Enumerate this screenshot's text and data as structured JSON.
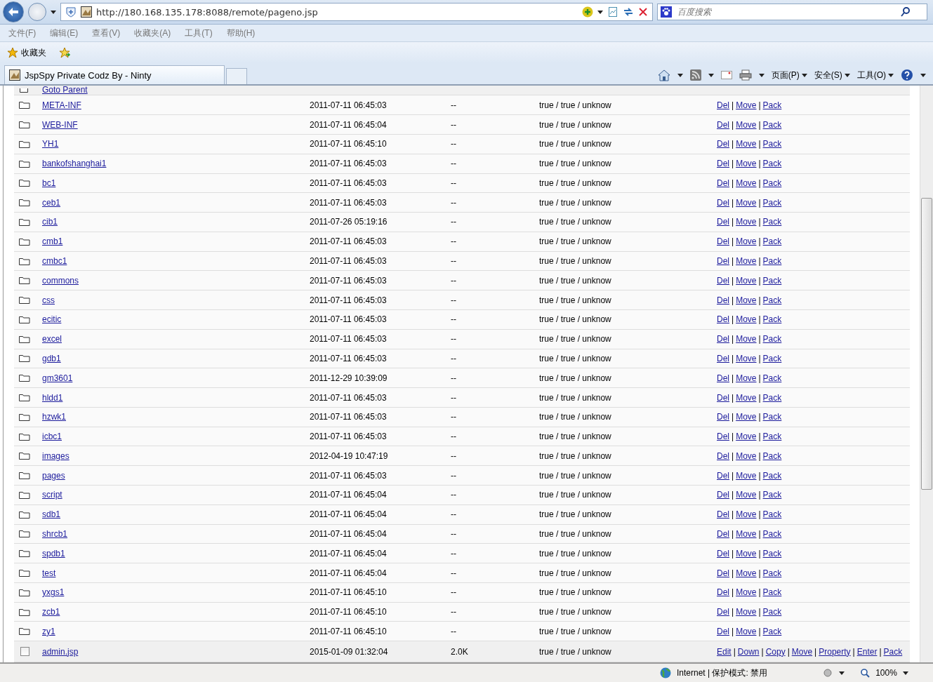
{
  "action_separator": "|",
  "address_bar": {
    "url": "http://180.168.135.178:8088/remote/pageno.jsp",
    "search_placeholder": "百度搜索"
  },
  "menu_bar": [
    "文件(F)",
    "编辑(E)",
    "查看(V)",
    "收藏夹(A)",
    "工具(T)",
    "帮助(H)"
  ],
  "favorites_bar": {
    "label": "收藏夹"
  },
  "tab": {
    "title": "JspSpy Private Codz By - Ninty"
  },
  "command_bar": [
    "页面(P)",
    "安全(S)",
    "工具(O)"
  ],
  "listing": {
    "parent_link": "Goto Parent",
    "rows": [
      {
        "kind": "folder",
        "name": "META-INF",
        "modified": "2011-07-11 06:45:03",
        "size": "--",
        "permissions": "true / true / unknow",
        "actions": [
          "Del",
          "Move",
          "Pack"
        ]
      },
      {
        "kind": "folder",
        "name": "WEB-INF",
        "modified": "2011-07-11 06:45:04",
        "size": "--",
        "permissions": "true / true / unknow",
        "actions": [
          "Del",
          "Move",
          "Pack"
        ]
      },
      {
        "kind": "folder",
        "name": "YH1",
        "modified": "2011-07-11 06:45:10",
        "size": "--",
        "permissions": "true / true / unknow",
        "actions": [
          "Del",
          "Move",
          "Pack"
        ]
      },
      {
        "kind": "folder",
        "name": "bankofshanghai1",
        "modified": "2011-07-11 06:45:03",
        "size": "--",
        "permissions": "true / true / unknow",
        "actions": [
          "Del",
          "Move",
          "Pack"
        ]
      },
      {
        "kind": "folder",
        "name": "bc1",
        "modified": "2011-07-11 06:45:03",
        "size": "--",
        "permissions": "true / true / unknow",
        "actions": [
          "Del",
          "Move",
          "Pack"
        ]
      },
      {
        "kind": "folder",
        "name": "ceb1",
        "modified": "2011-07-11 06:45:03",
        "size": "--",
        "permissions": "true / true / unknow",
        "actions": [
          "Del",
          "Move",
          "Pack"
        ]
      },
      {
        "kind": "folder",
        "name": "cib1",
        "modified": "2011-07-26 05:19:16",
        "size": "--",
        "permissions": "true / true / unknow",
        "actions": [
          "Del",
          "Move",
          "Pack"
        ]
      },
      {
        "kind": "folder",
        "name": "cmb1",
        "modified": "2011-07-11 06:45:03",
        "size": "--",
        "permissions": "true / true / unknow",
        "actions": [
          "Del",
          "Move",
          "Pack"
        ]
      },
      {
        "kind": "folder",
        "name": "cmbc1",
        "modified": "2011-07-11 06:45:03",
        "size": "--",
        "permissions": "true / true / unknow",
        "actions": [
          "Del",
          "Move",
          "Pack"
        ]
      },
      {
        "kind": "folder",
        "name": "commons",
        "modified": "2011-07-11 06:45:03",
        "size": "--",
        "permissions": "true / true / unknow",
        "actions": [
          "Del",
          "Move",
          "Pack"
        ]
      },
      {
        "kind": "folder",
        "name": "css",
        "modified": "2011-07-11 06:45:03",
        "size": "--",
        "permissions": "true / true / unknow",
        "actions": [
          "Del",
          "Move",
          "Pack"
        ]
      },
      {
        "kind": "folder",
        "name": "ecitic",
        "modified": "2011-07-11 06:45:03",
        "size": "--",
        "permissions": "true / true / unknow",
        "actions": [
          "Del",
          "Move",
          "Pack"
        ]
      },
      {
        "kind": "folder",
        "name": "excel",
        "modified": "2011-07-11 06:45:03",
        "size": "--",
        "permissions": "true / true / unknow",
        "actions": [
          "Del",
          "Move",
          "Pack"
        ]
      },
      {
        "kind": "folder",
        "name": "gdb1",
        "modified": "2011-07-11 06:45:03",
        "size": "--",
        "permissions": "true / true / unknow",
        "actions": [
          "Del",
          "Move",
          "Pack"
        ]
      },
      {
        "kind": "folder",
        "name": "gm3601",
        "modified": "2011-12-29 10:39:09",
        "size": "--",
        "permissions": "true / true / unknow",
        "actions": [
          "Del",
          "Move",
          "Pack"
        ]
      },
      {
        "kind": "folder",
        "name": "hldd1",
        "modified": "2011-07-11 06:45:03",
        "size": "--",
        "permissions": "true / true / unknow",
        "actions": [
          "Del",
          "Move",
          "Pack"
        ]
      },
      {
        "kind": "folder",
        "name": "hzwk1",
        "modified": "2011-07-11 06:45:03",
        "size": "--",
        "permissions": "true / true / unknow",
        "actions": [
          "Del",
          "Move",
          "Pack"
        ]
      },
      {
        "kind": "folder",
        "name": "icbc1",
        "modified": "2011-07-11 06:45:03",
        "size": "--",
        "permissions": "true / true / unknow",
        "actions": [
          "Del",
          "Move",
          "Pack"
        ]
      },
      {
        "kind": "folder",
        "name": "images",
        "modified": "2012-04-19 10:47:19",
        "size": "--",
        "permissions": "true / true / unknow",
        "actions": [
          "Del",
          "Move",
          "Pack"
        ]
      },
      {
        "kind": "folder",
        "name": "pages",
        "modified": "2011-07-11 06:45:03",
        "size": "--",
        "permissions": "true / true / unknow",
        "actions": [
          "Del",
          "Move",
          "Pack"
        ]
      },
      {
        "kind": "folder",
        "name": "script",
        "modified": "2011-07-11 06:45:04",
        "size": "--",
        "permissions": "true / true / unknow",
        "actions": [
          "Del",
          "Move",
          "Pack"
        ]
      },
      {
        "kind": "folder",
        "name": "sdb1",
        "modified": "2011-07-11 06:45:04",
        "size": "--",
        "permissions": "true / true / unknow",
        "actions": [
          "Del",
          "Move",
          "Pack"
        ]
      },
      {
        "kind": "folder",
        "name": "shrcb1",
        "modified": "2011-07-11 06:45:04",
        "size": "--",
        "permissions": "true / true / unknow",
        "actions": [
          "Del",
          "Move",
          "Pack"
        ]
      },
      {
        "kind": "folder",
        "name": "spdb1",
        "modified": "2011-07-11 06:45:04",
        "size": "--",
        "permissions": "true / true / unknow",
        "actions": [
          "Del",
          "Move",
          "Pack"
        ]
      },
      {
        "kind": "folder",
        "name": "test",
        "modified": "2011-07-11 06:45:04",
        "size": "--",
        "permissions": "true / true / unknow",
        "actions": [
          "Del",
          "Move",
          "Pack"
        ]
      },
      {
        "kind": "folder",
        "name": "yxgs1",
        "modified": "2011-07-11 06:45:10",
        "size": "--",
        "permissions": "true / true / unknow",
        "actions": [
          "Del",
          "Move",
          "Pack"
        ]
      },
      {
        "kind": "folder",
        "name": "zcb1",
        "modified": "2011-07-11 06:45:10",
        "size": "--",
        "permissions": "true / true / unknow",
        "actions": [
          "Del",
          "Move",
          "Pack"
        ]
      },
      {
        "kind": "folder",
        "name": "zy1",
        "modified": "2011-07-11 06:45:10",
        "size": "--",
        "permissions": "true / true / unknow",
        "actions": [
          "Del",
          "Move",
          "Pack"
        ]
      },
      {
        "kind": "file",
        "checked": false,
        "name": "admin.jsp",
        "modified": "2015-01-09 01:32:04",
        "size": "2.0K",
        "permissions": "true / true / unknow",
        "actions": [
          "Edit",
          "Down",
          "Copy",
          "Move",
          "Property",
          "Enter",
          "Pack"
        ]
      }
    ]
  },
  "status_bar": {
    "zone": "Internet | 保护模式: 禁用",
    "zoom": "100%"
  }
}
